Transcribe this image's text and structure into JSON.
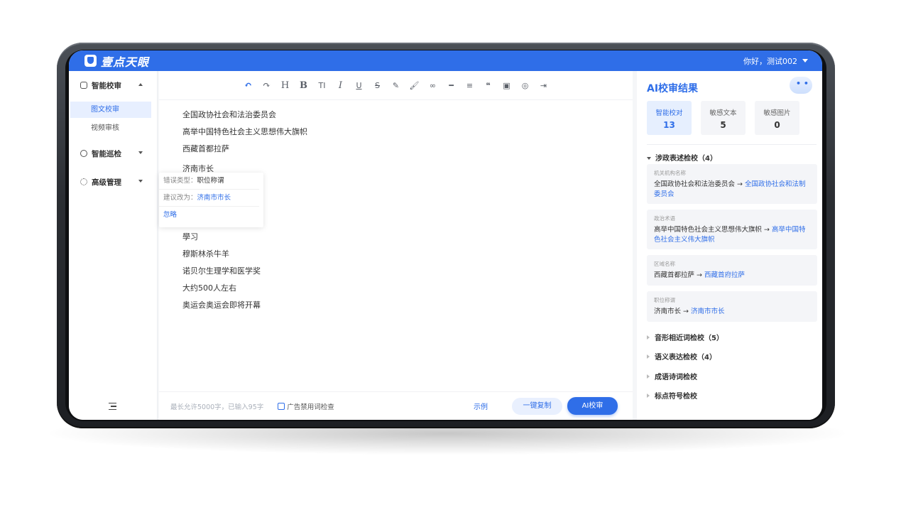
{
  "header": {
    "brand": "壹点天眼",
    "greeting": "你好，测试002"
  },
  "sidebar": {
    "groups": [
      {
        "label": "智能校审",
        "subitems": [
          "图文校审",
          "视频审核"
        ]
      },
      {
        "label": "智能巡检"
      },
      {
        "label": "高级管理"
      }
    ]
  },
  "toolbar": {
    "icons": [
      "undo-icon",
      "redo-icon",
      "heading-icon",
      "bold-icon",
      "font-size-icon",
      "italic-icon",
      "underline-icon",
      "strikethrough-icon",
      "highlight-icon",
      "brush-icon",
      "link-icon",
      "hr-icon",
      "align-icon",
      "quote-icon",
      "image-icon",
      "wechat-icon",
      "import-icon"
    ],
    "glyphs": {
      "heading": "H",
      "bold": "B",
      "fontsize": "TI",
      "italic": "I",
      "underline": "U",
      "strike": "S"
    }
  },
  "editor": {
    "lines": [
      "全国政协社会和法治委员会",
      "高举中国特色社会主义思想伟大旗帜",
      "西藏首都拉萨",
      "济南市长",
      "學习",
      "穆斯林杀牛羊",
      "诺贝尔生理学和医学奖",
      "大约500人左右",
      "奥运会奥运会即将开幕"
    ],
    "popup": {
      "error_label": "错误类型：",
      "error_value": "职位称谓",
      "suggest_label": "建议改为：",
      "suggest_value": "济南市市长",
      "ignore": "忽略"
    },
    "footer": {
      "counter": "最长允许5000字，已输入95字",
      "ad_check": "广告禁用词检查",
      "example": "示例",
      "copy": "一键复制",
      "ai_check": "AI校审"
    }
  },
  "results": {
    "title": "AI校审结果",
    "stats": [
      {
        "label": "智能校对",
        "value": "13"
      },
      {
        "label": "敏感文本",
        "value": "5"
      },
      {
        "label": "敏感图片",
        "value": "0"
      }
    ],
    "open_category": "涉政表述检校（4）",
    "cards": [
      {
        "type": "机关机构名称",
        "original": "全国政协社会和法治委员会",
        "arrow": "→",
        "suggestion": "全国政协社会和法制委员会"
      },
      {
        "type": "政治术语",
        "original": "高举中国特色社会主义思想伟大旗帜",
        "arrow": "→",
        "suggestion": "高举中国特色社会主义伟大旗帜"
      },
      {
        "type": "区域名称",
        "original": "西藏首都拉萨",
        "arrow": "→",
        "suggestion": "西藏首府拉萨"
      },
      {
        "type": "职位称谓",
        "original": "济南市长",
        "arrow": "→",
        "suggestion": "济南市市长"
      }
    ],
    "categories": [
      "音形相近词检校（5）",
      "语义表达检校（4）",
      "成语诗词检校",
      "标点符号检校"
    ]
  },
  "colors": {
    "accent": "#2f6ee8",
    "topbar": "#2f6ee8"
  }
}
